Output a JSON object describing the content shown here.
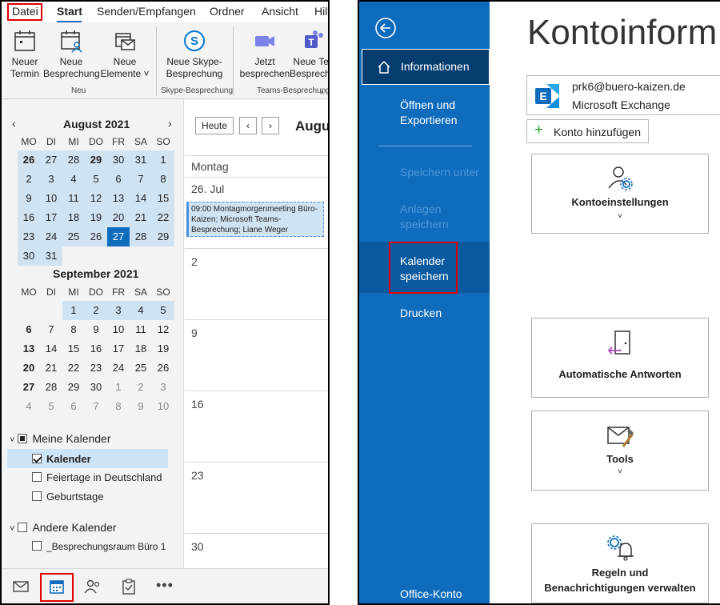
{
  "tabs": {
    "datei": "Datei",
    "start": "Start",
    "senden": "Senden/Empfangen",
    "ordner": "Ordner",
    "ansicht": "Ansicht",
    "hilfe": "Hilf"
  },
  "ribbon": {
    "neuer_termin_1": "Neuer",
    "neuer_termin_2": "Termin",
    "neue_besprechung_1": "Neue",
    "neue_besprechung_2": "Besprechung",
    "neue_elemente_1": "Neue",
    "neue_elemente_2": "Elemente",
    "group_neu": "Neu",
    "skype_1": "Neue Skype-",
    "skype_2": "Besprechung",
    "group_skype": "Skype-Besprechung",
    "jetzt_1": "Jetzt",
    "jetzt_2": "besprechen",
    "teams_1": "Neue Tea",
    "teams_2": "Besprechun",
    "group_teams": "Teams-Besprechung"
  },
  "dow": [
    "MO",
    "DI",
    "MI",
    "DO",
    "FR",
    "SA",
    "SO"
  ],
  "august": {
    "title": "August 2021",
    "weeks": [
      [
        "26",
        "27",
        "28",
        "29",
        "30",
        "31",
        "1"
      ],
      [
        "2",
        "3",
        "4",
        "5",
        "6",
        "7",
        "8"
      ],
      [
        "9",
        "10",
        "11",
        "12",
        "13",
        "14",
        "15"
      ],
      [
        "16",
        "17",
        "18",
        "19",
        "20",
        "21",
        "22"
      ],
      [
        "23",
        "24",
        "25",
        "26",
        "27",
        "28",
        "29"
      ],
      [
        "30",
        "31"
      ]
    ]
  },
  "september": {
    "title": "September 2021",
    "weeks": [
      [
        "",
        "",
        "1",
        "2",
        "3",
        "4",
        "5"
      ],
      [
        "6",
        "7",
        "8",
        "9",
        "10",
        "11",
        "12"
      ],
      [
        "13",
        "14",
        "15",
        "16",
        "17",
        "18",
        "19"
      ],
      [
        "20",
        "21",
        "22",
        "23",
        "24",
        "25",
        "26"
      ],
      [
        "27",
        "28",
        "29",
        "30",
        "1",
        "2",
        "3"
      ],
      [
        "4",
        "5",
        "6",
        "7",
        "8",
        "9",
        "10"
      ]
    ]
  },
  "calendars": {
    "mine_header": "Meine Kalender",
    "kalender": "Kalender",
    "feiertage": "Feiertage in Deutschland",
    "geburtstage": "Geburtstage",
    "other_header": "Andere Kalender",
    "raum": "_Besprechungsraum Büro 1"
  },
  "calview": {
    "heute": "Heute",
    "month": "Augu",
    "weekday": "Montag",
    "day1": "26. Jul",
    "event": "09:00 Montagmorgenmeeting Büro-Kaizen; Microsoft Teams-Besprechung; Liane Weger",
    "days": [
      "2",
      "9",
      "16",
      "23",
      "30"
    ]
  },
  "backstage": {
    "informationen": "Informationen",
    "oeffnen_1": "Öffnen und",
    "oeffnen_2": "Exportieren",
    "speichern_unter": "Speichern unter",
    "anlagen_1": "Anlagen",
    "anlagen_2": "speichern",
    "kalender_1": "Kalender",
    "kalender_2": "speichern",
    "drucken": "Drucken",
    "office_konto": "Office-Konto"
  },
  "account": {
    "title": "Kontoinform",
    "email": "prk6@buero-kaizen.de",
    "type": "Microsoft Exchange",
    "add": "Konto hinzufügen"
  },
  "cards": {
    "konto": "Kontoeinstellungen",
    "auto": "Automatische Antworten",
    "tools": "Tools",
    "regeln_1": "Regeln und",
    "regeln_2": "Benachrichtigungen verwalten"
  },
  "colors": {
    "accent": "#0f6cbd",
    "highlight": "#e00000",
    "selected": "#cfe3f3"
  }
}
